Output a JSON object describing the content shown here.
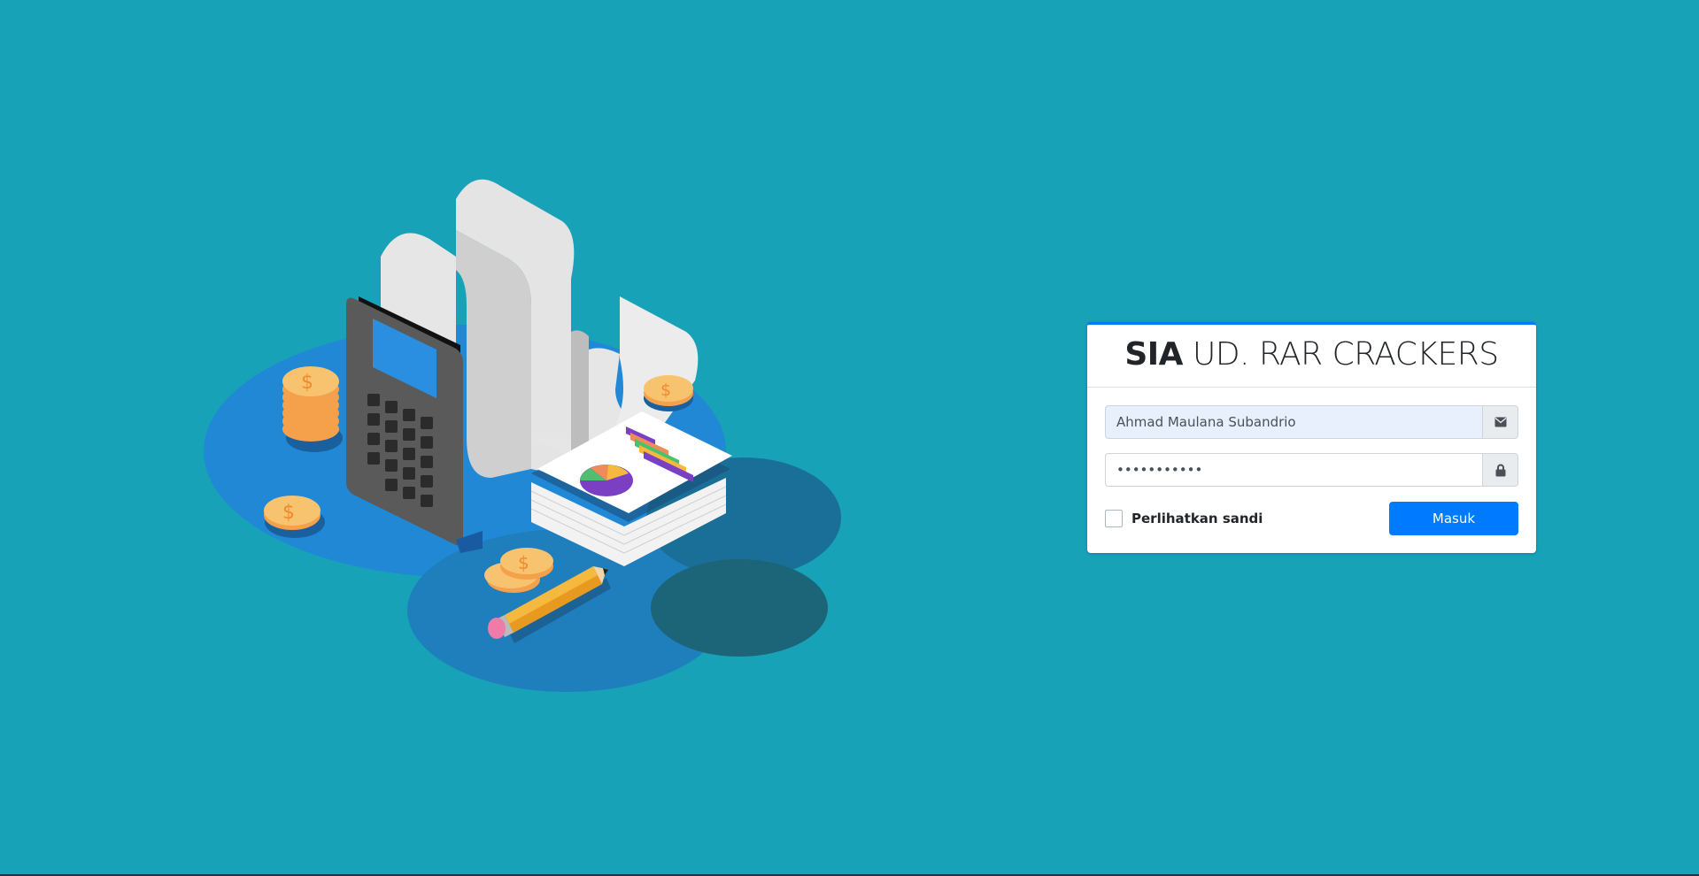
{
  "brand": {
    "bold": "SIA",
    "rest": " UD. RAR CRACKERS"
  },
  "login": {
    "username_value": "Ahmad Maulana Subandrio",
    "password_value": "•••••••••••",
    "show_password_label": "Perlihatkan sandi",
    "submit_label": "Masuk"
  },
  "icons": {
    "username_addon": "envelope-icon",
    "password_addon": "lock-icon"
  },
  "colors": {
    "background": "#17a2b8",
    "accent": "#007bff"
  }
}
